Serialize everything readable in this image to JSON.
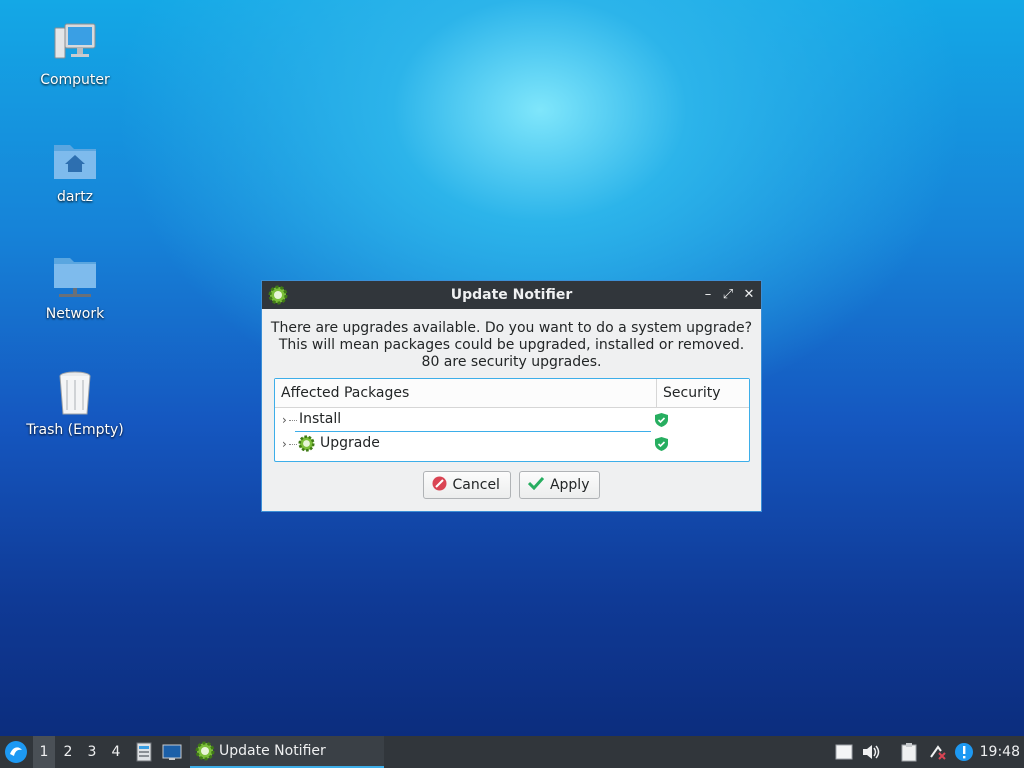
{
  "desktop": {
    "icons": [
      {
        "label": "Computer",
        "icon": "computer-icon"
      },
      {
        "label": "dartz",
        "icon": "home-folder-icon"
      },
      {
        "label": "Network",
        "icon": "network-folder-icon"
      },
      {
        "label": "Trash (Empty)",
        "icon": "trash-icon"
      }
    ]
  },
  "dialog": {
    "title": "Update Notifier",
    "window_buttons": {
      "minimize": "–",
      "maximize": "⤢",
      "close": "✕"
    },
    "message": [
      "There are upgrades available. Do you want to do a system upgrade?",
      "This will mean packages could be upgraded, installed or removed.",
      "80 are security upgrades."
    ],
    "table": {
      "columns": [
        "Affected Packages",
        "Security"
      ],
      "rows": [
        {
          "label": "Install",
          "expander": "›",
          "security": "shield-check-icon"
        },
        {
          "label": "Upgrade",
          "expander": "›",
          "security": "shield-check-icon"
        }
      ]
    },
    "buttons": {
      "cancel": "Cancel",
      "apply": "Apply"
    }
  },
  "taskbar": {
    "workspaces": [
      "1",
      "2",
      "3",
      "4"
    ],
    "active_workspace": "1",
    "task_label": "Update Notifier",
    "clock": "19:48"
  },
  "colors": {
    "accent": "#3daee9",
    "panel": "#31363b",
    "cancel_red": "#da4453",
    "apply_green": "#27ae60"
  }
}
